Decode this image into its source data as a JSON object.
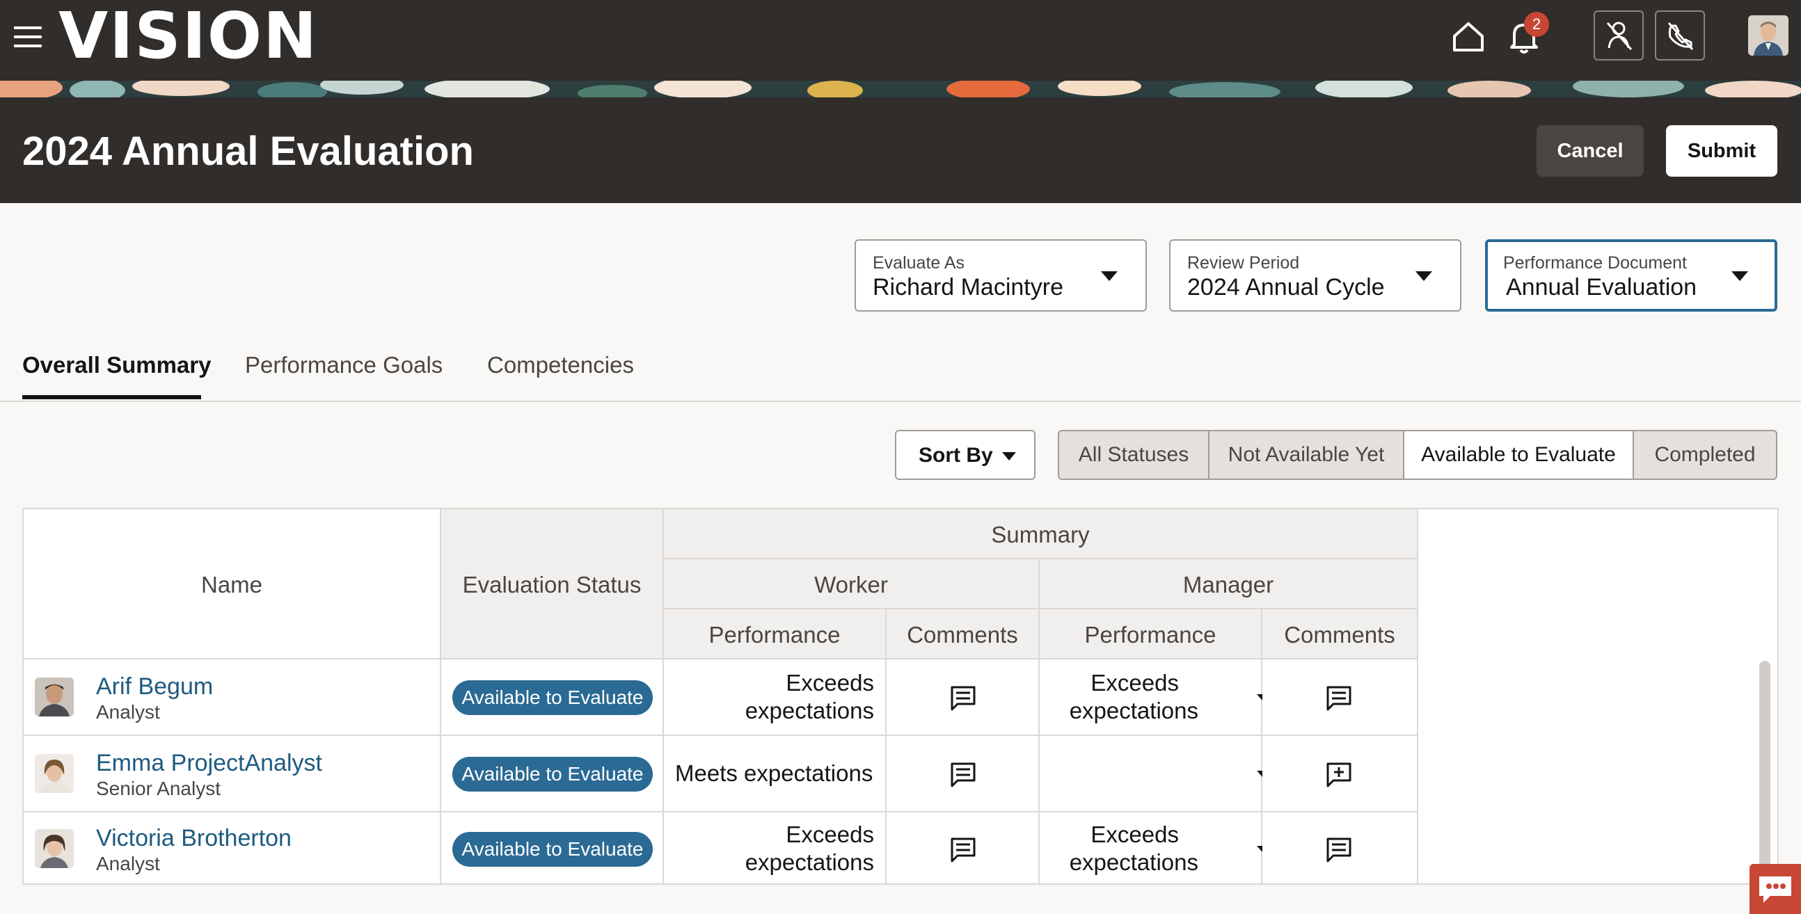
{
  "app": {
    "logo": "VISION",
    "notification_count": "2"
  },
  "header": {
    "title": "2024 Annual Evaluation",
    "cancel_label": "Cancel",
    "submit_label": "Submit"
  },
  "filters": {
    "evaluate_as": {
      "label": "Evaluate As",
      "value": "Richard Macintyre"
    },
    "review_period": {
      "label": "Review Period",
      "value": "2024 Annual Cycle"
    },
    "performance_document": {
      "label": "Performance Document",
      "value": "Annual Evaluation"
    }
  },
  "tabs": [
    {
      "label": "Overall Summary",
      "active": true
    },
    {
      "label": "Performance Goals",
      "active": false
    },
    {
      "label": "Competencies",
      "active": false
    }
  ],
  "toolbar": {
    "sort_label": "Sort By",
    "status_filters": [
      "All Statuses",
      "Not Available Yet",
      "Available to Evaluate",
      "Completed"
    ],
    "selected_status": "Available to Evaluate"
  },
  "table": {
    "headers": {
      "name": "Name",
      "status": "Evaluation Status",
      "summary": "Summary",
      "worker": "Worker",
      "manager": "Manager",
      "performance": "Performance",
      "comments": "Comments"
    },
    "rows": [
      {
        "name": "Arif Begum",
        "role": "Analyst",
        "status": "Available to Evaluate",
        "worker_rating_1": "Exceeds",
        "worker_rating_2": "expectations",
        "manager_rating_1": "Exceeds",
        "manager_rating_2": "expectations",
        "manager_comment_icon": "comment-icon"
      },
      {
        "name": "Emma ProjectAnalyst",
        "role": "Senior Analyst",
        "status": "Available to Evaluate",
        "worker_rating_1": "Meets expectations",
        "worker_rating_2": "",
        "manager_rating_1": "",
        "manager_rating_2": "",
        "manager_comment_icon": "add-comment-icon"
      },
      {
        "name": "Victoria Brotherton",
        "role": "Analyst",
        "status": "Available to Evaluate",
        "worker_rating_1": "Exceeds",
        "worker_rating_2": "expectations",
        "manager_rating_1": "Exceeds",
        "manager_rating_2": "expectations",
        "manager_comment_icon": "comment-icon"
      }
    ]
  },
  "colors": {
    "topbar": "#312d2a",
    "link": "#1e5a80",
    "status_pill": "#2b6a94",
    "badge": "#c74634"
  }
}
